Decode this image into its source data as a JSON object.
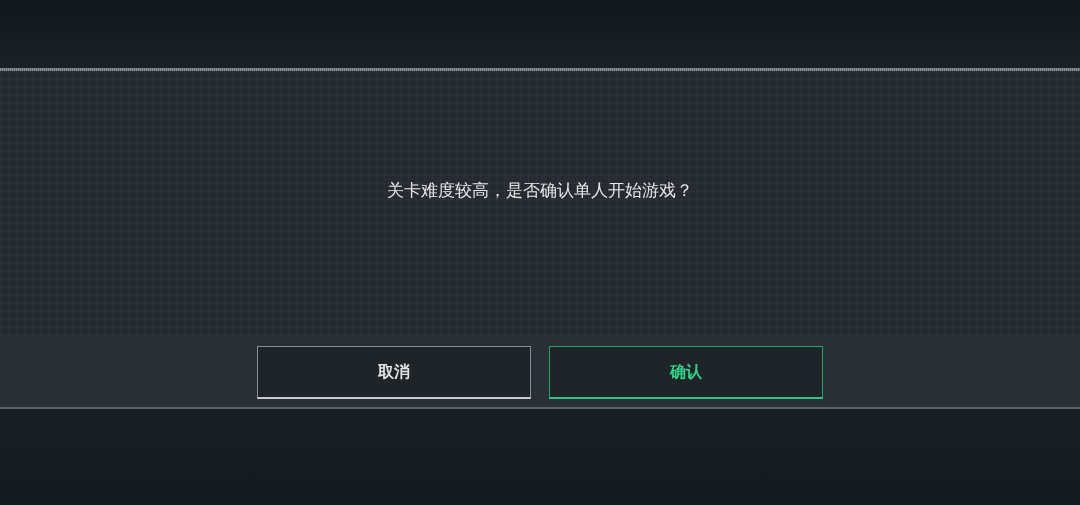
{
  "dialog": {
    "message": "关卡难度较高，是否确认单人开始游戏？",
    "buttons": [
      {
        "label": "取消",
        "kind": "cancel"
      },
      {
        "label": "确认",
        "kind": "confirm"
      }
    ]
  }
}
